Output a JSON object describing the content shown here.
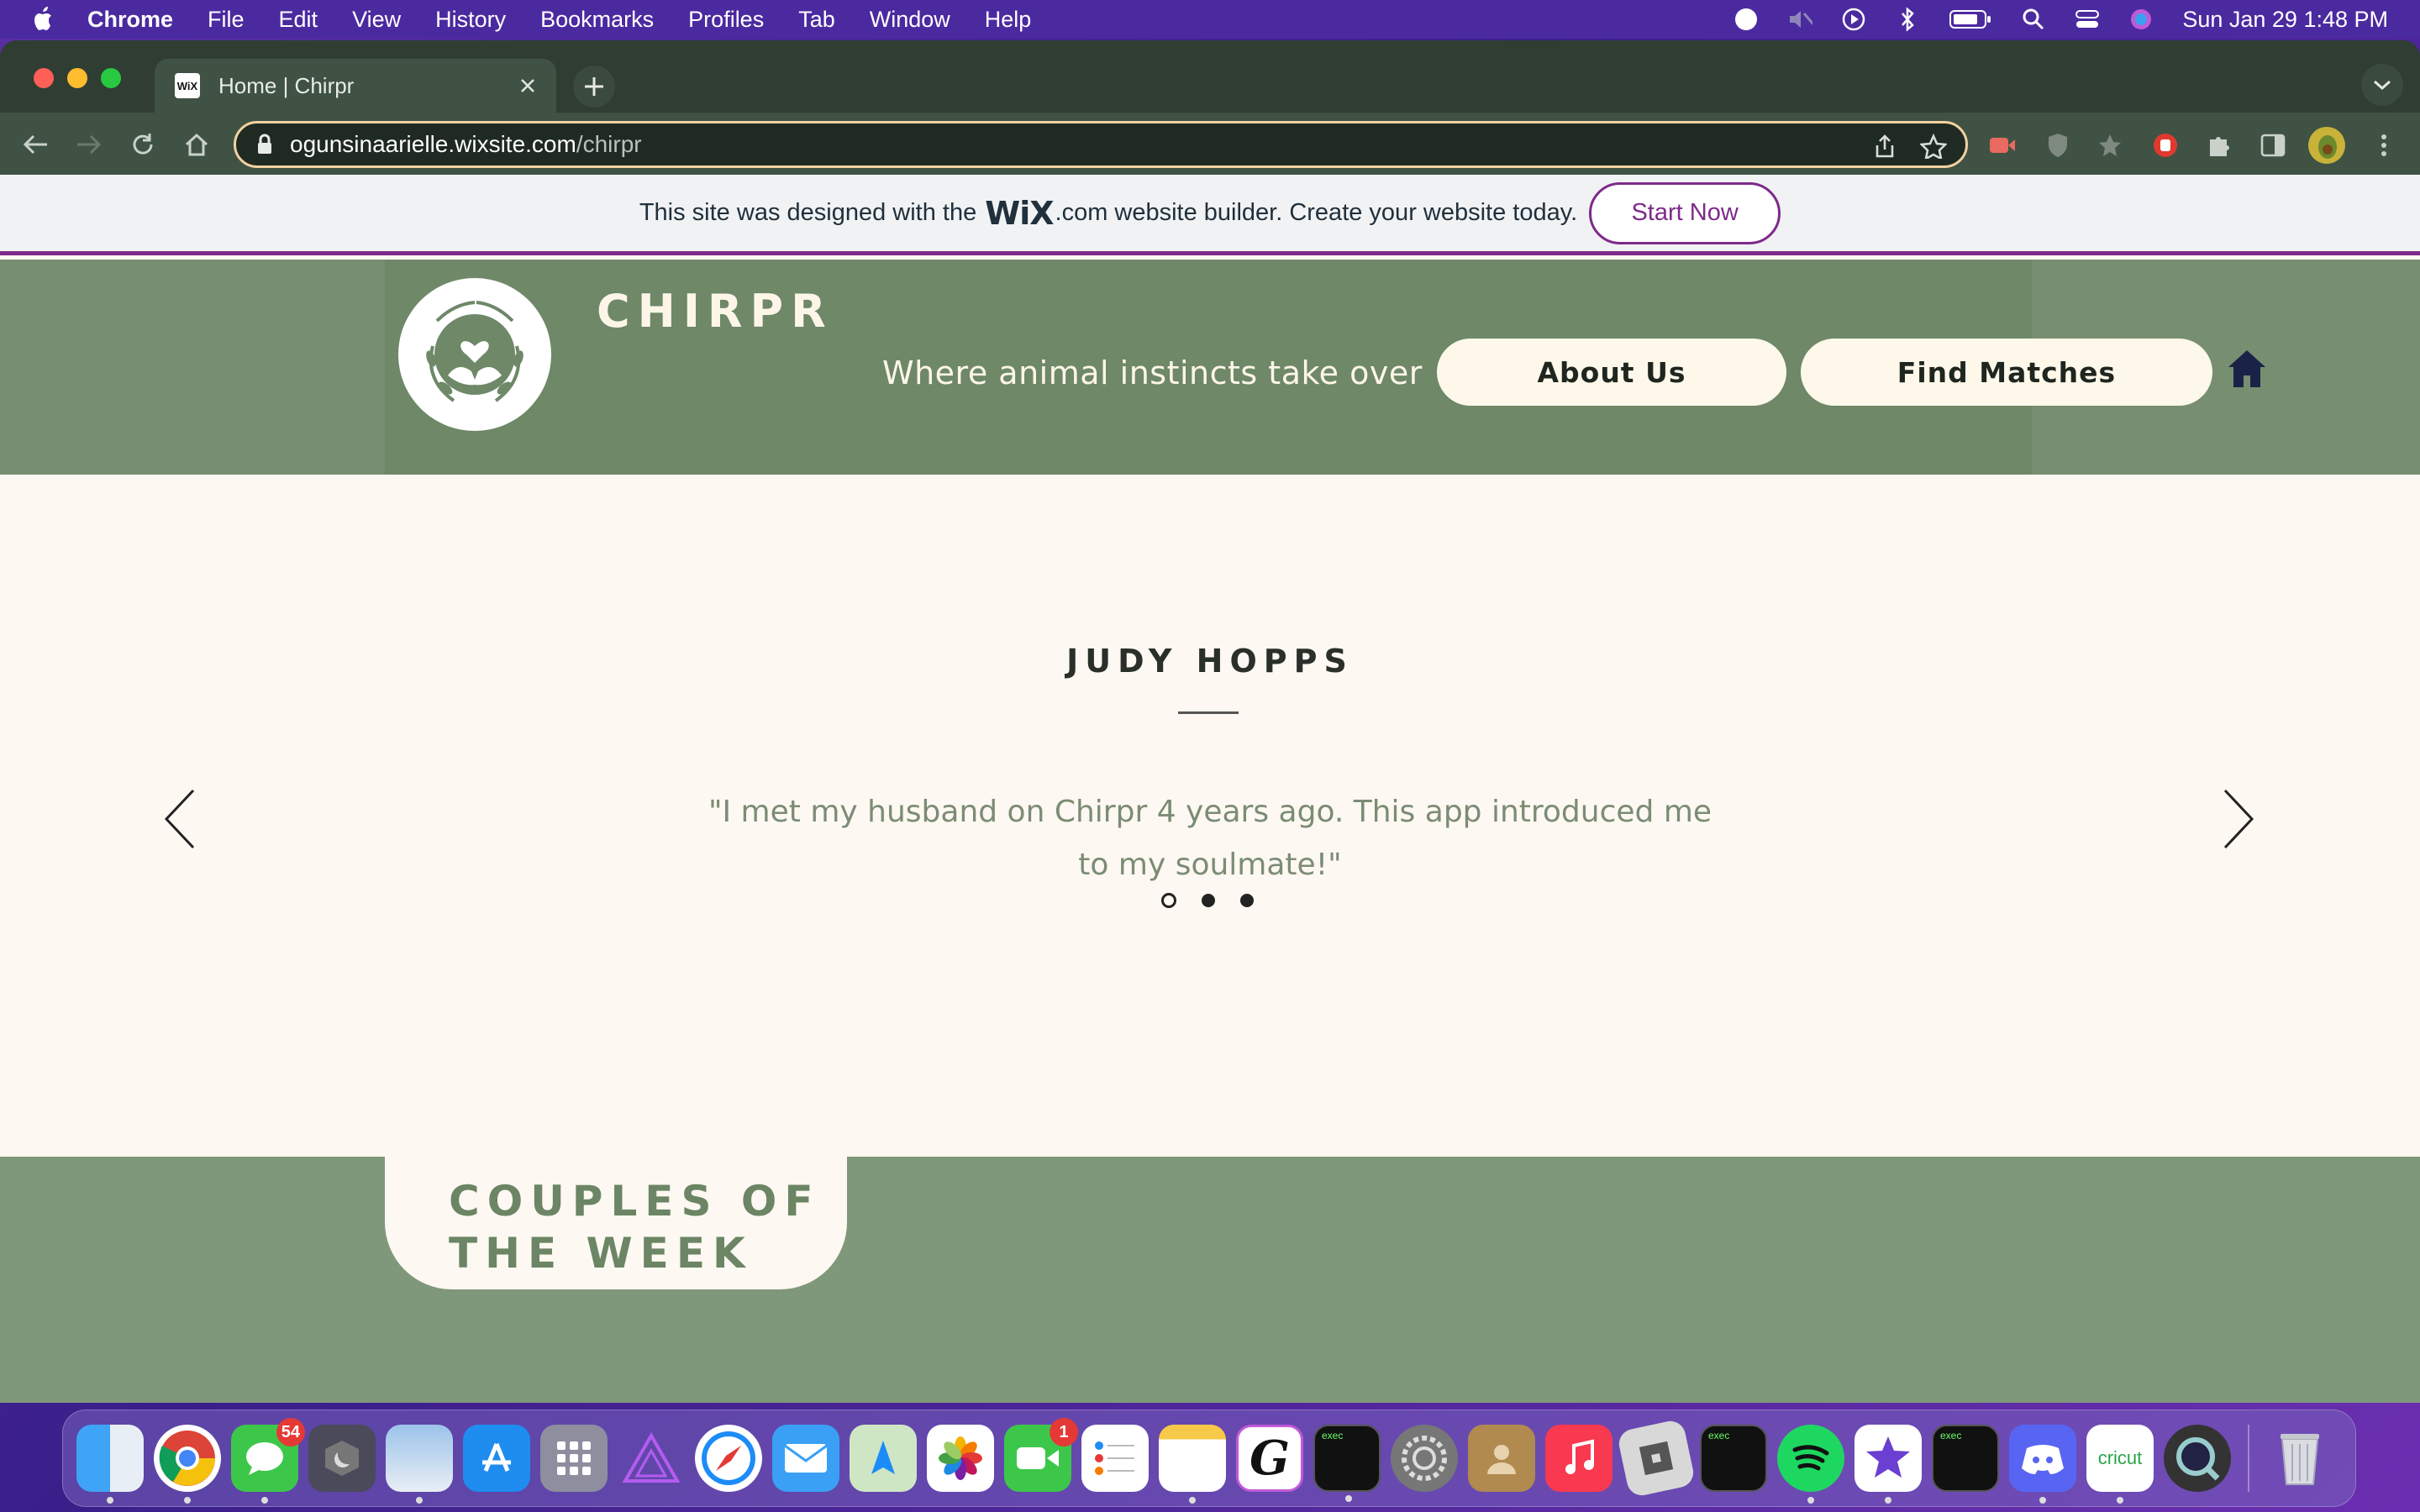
{
  "menubar": {
    "items": [
      "Chrome",
      "File",
      "Edit",
      "View",
      "History",
      "Bookmarks",
      "Profiles",
      "Tab",
      "Window",
      "Help"
    ],
    "clock": "Sun Jan 29  1:48 PM"
  },
  "browser": {
    "tab_title": "Home | Chirpr",
    "favicon_text": "WiX",
    "url_host": "ogunsinaarielle.wixsite.com",
    "url_path": "/chirpr"
  },
  "wix_banner": {
    "text_before": "This site was designed with the",
    "logo": "WiX",
    "dotcom": ".com",
    "text_after": "website builder. Create your website today.",
    "cta": "Start Now"
  },
  "site": {
    "brand": "CHIRPR",
    "tagline": "Where animal instincts take over",
    "nav": [
      "About Us",
      "Find Matches"
    ]
  },
  "testimonial": {
    "name": "JUDY HOPPS",
    "quote": "\"I met my husband on Chirpr 4 years ago. This app introduced me to my soulmate!\"",
    "active_slide": 1,
    "slide_count": 3
  },
  "couples": {
    "title_line1": "COUPLES OF",
    "title_line2": "THE WEEK"
  },
  "dock": {
    "messages_badge": "54",
    "facetime_badge": "1",
    "exec_label": "exec",
    "cricut_label": "cricut"
  },
  "colors": {
    "header_green": "#6e8868",
    "page_cream": "#fdf8f2",
    "quote_green": "#7b8c74",
    "wix_purple": "#7d2a8a"
  }
}
